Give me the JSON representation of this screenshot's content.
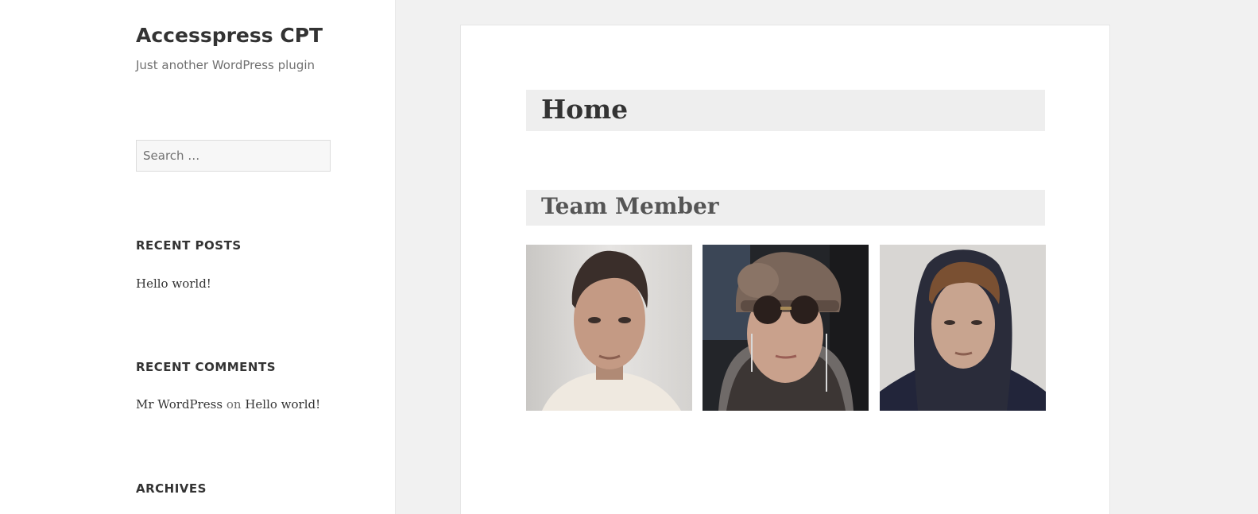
{
  "site": {
    "title": "Accesspress CPT",
    "description": "Just another WordPress plugin"
  },
  "search": {
    "placeholder": "Search …"
  },
  "widgets": {
    "recent_posts": {
      "title": "RECENT POSTS",
      "items": [
        "Hello world!"
      ]
    },
    "recent_comments": {
      "title": "RECENT COMMENTS",
      "author": "Mr WordPress",
      "connector": "on",
      "post": "Hello world!"
    },
    "archives": {
      "title": "ARCHIVES"
    }
  },
  "main": {
    "page_title": "Home",
    "section_title": "Team Member",
    "members": [
      {
        "icon": "man-portrait"
      },
      {
        "icon": "woman-with-hat-portrait"
      },
      {
        "icon": "man-in-hood-portrait"
      }
    ]
  }
}
